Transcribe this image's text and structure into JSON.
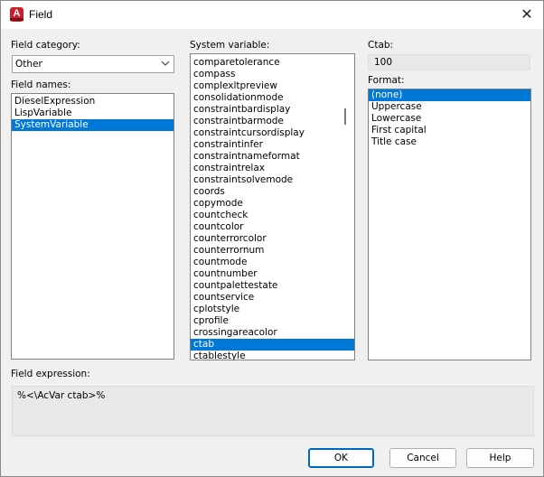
{
  "window": {
    "title": "Field",
    "app_icon_letter": "A"
  },
  "field_category": {
    "label": "Field category:",
    "value": "Other"
  },
  "field_names": {
    "label": "Field names:",
    "items": [
      "DieselExpression",
      "LispVariable",
      "SystemVariable"
    ],
    "selected": 2
  },
  "system_variable": {
    "label": "System variable:",
    "items": [
      "comparetolerance",
      "compass",
      "complexltpreview",
      "consolidationmode",
      "constraintbardisplay",
      "constraintbarmode",
      "constraintcursordisplay",
      "constraintinfer",
      "constraintnameformat",
      "constraintrelax",
      "constraintsolvemode",
      "coords",
      "copymode",
      "countcheck",
      "countcolor",
      "counterrorcolor",
      "counterrornum",
      "countmode",
      "countnumber",
      "countpalettestate",
      "countservice",
      "cplotstyle",
      "cprofile",
      "crossingareacolor",
      "ctab",
      "ctablestyle"
    ],
    "selected": 24
  },
  "ctab": {
    "label": "Ctab:",
    "value": "100"
  },
  "format": {
    "label": "Format:",
    "items": [
      "(none)",
      "Uppercase",
      "Lowercase",
      "First capital",
      "Title case"
    ],
    "selected": 0
  },
  "field_expression": {
    "label": "Field expression:",
    "value": "%<\\AcVar ctab>%"
  },
  "buttons": {
    "ok": "OK",
    "cancel": "Cancel",
    "help": "Help"
  },
  "colors": {
    "selection": "#0078d7",
    "app_icon": "#c8202c"
  }
}
